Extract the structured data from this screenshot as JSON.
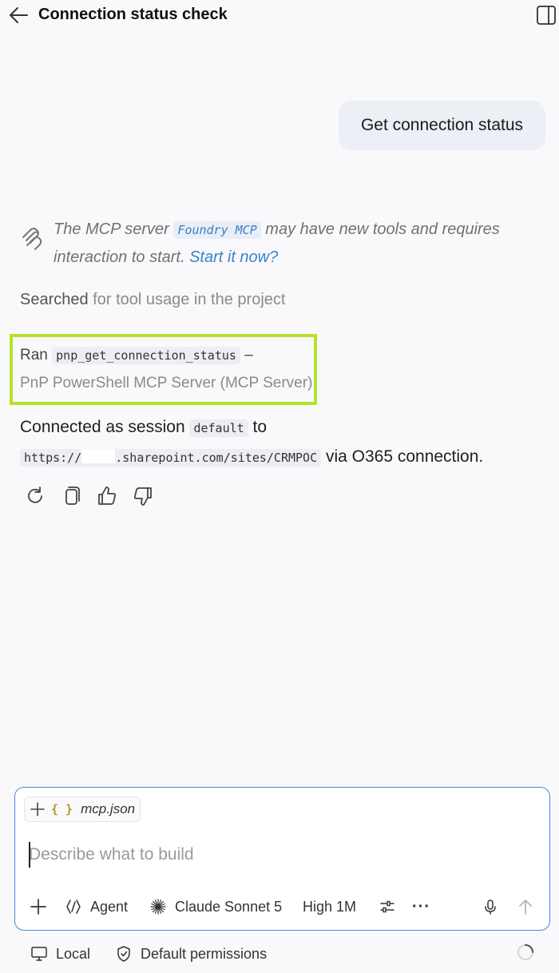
{
  "header": {
    "title": "Connection status check"
  },
  "user_message": "Get connection status",
  "mcp_notice": {
    "prefix": "The MCP server ",
    "server_name": "Foundry MCP",
    "middle": " may have new tools and requires interaction to start. ",
    "link_text": "Start it now?"
  },
  "searched": {
    "verb": "Searched",
    "detail": " for tool usage in the project"
  },
  "ran": {
    "verb": "Ran",
    "tool": "pnp_get_connection_status",
    "dash": "–",
    "server": "PnP PowerShell MCP Server (MCP Server)"
  },
  "response": {
    "line1_prefix": "Connected as session ",
    "session": "default",
    "line1_suffix": " to",
    "url_prefix": "https://",
    "url_suffix": ".sharepoint.com/sites/CRMPOC",
    "line2_suffix": " via O365 connection."
  },
  "actions": {
    "icons": [
      "retry-icon",
      "copy-icon",
      "thumbs-up-icon",
      "thumbs-down-icon"
    ]
  },
  "composer": {
    "context_file": "mcp.json",
    "context_icon": "{ }",
    "placeholder": "Describe what to build",
    "mode": "Agent",
    "model": "Claude Sonnet 5",
    "effort": "High 1M",
    "more": "···"
  },
  "footer": {
    "location": "Local",
    "permissions": "Default permissions"
  },
  "colors": {
    "highlight_box": "#b6e22a",
    "link": "#3a83c9",
    "composer_border": "#4a86d8",
    "user_bubble": "#eceff5"
  }
}
